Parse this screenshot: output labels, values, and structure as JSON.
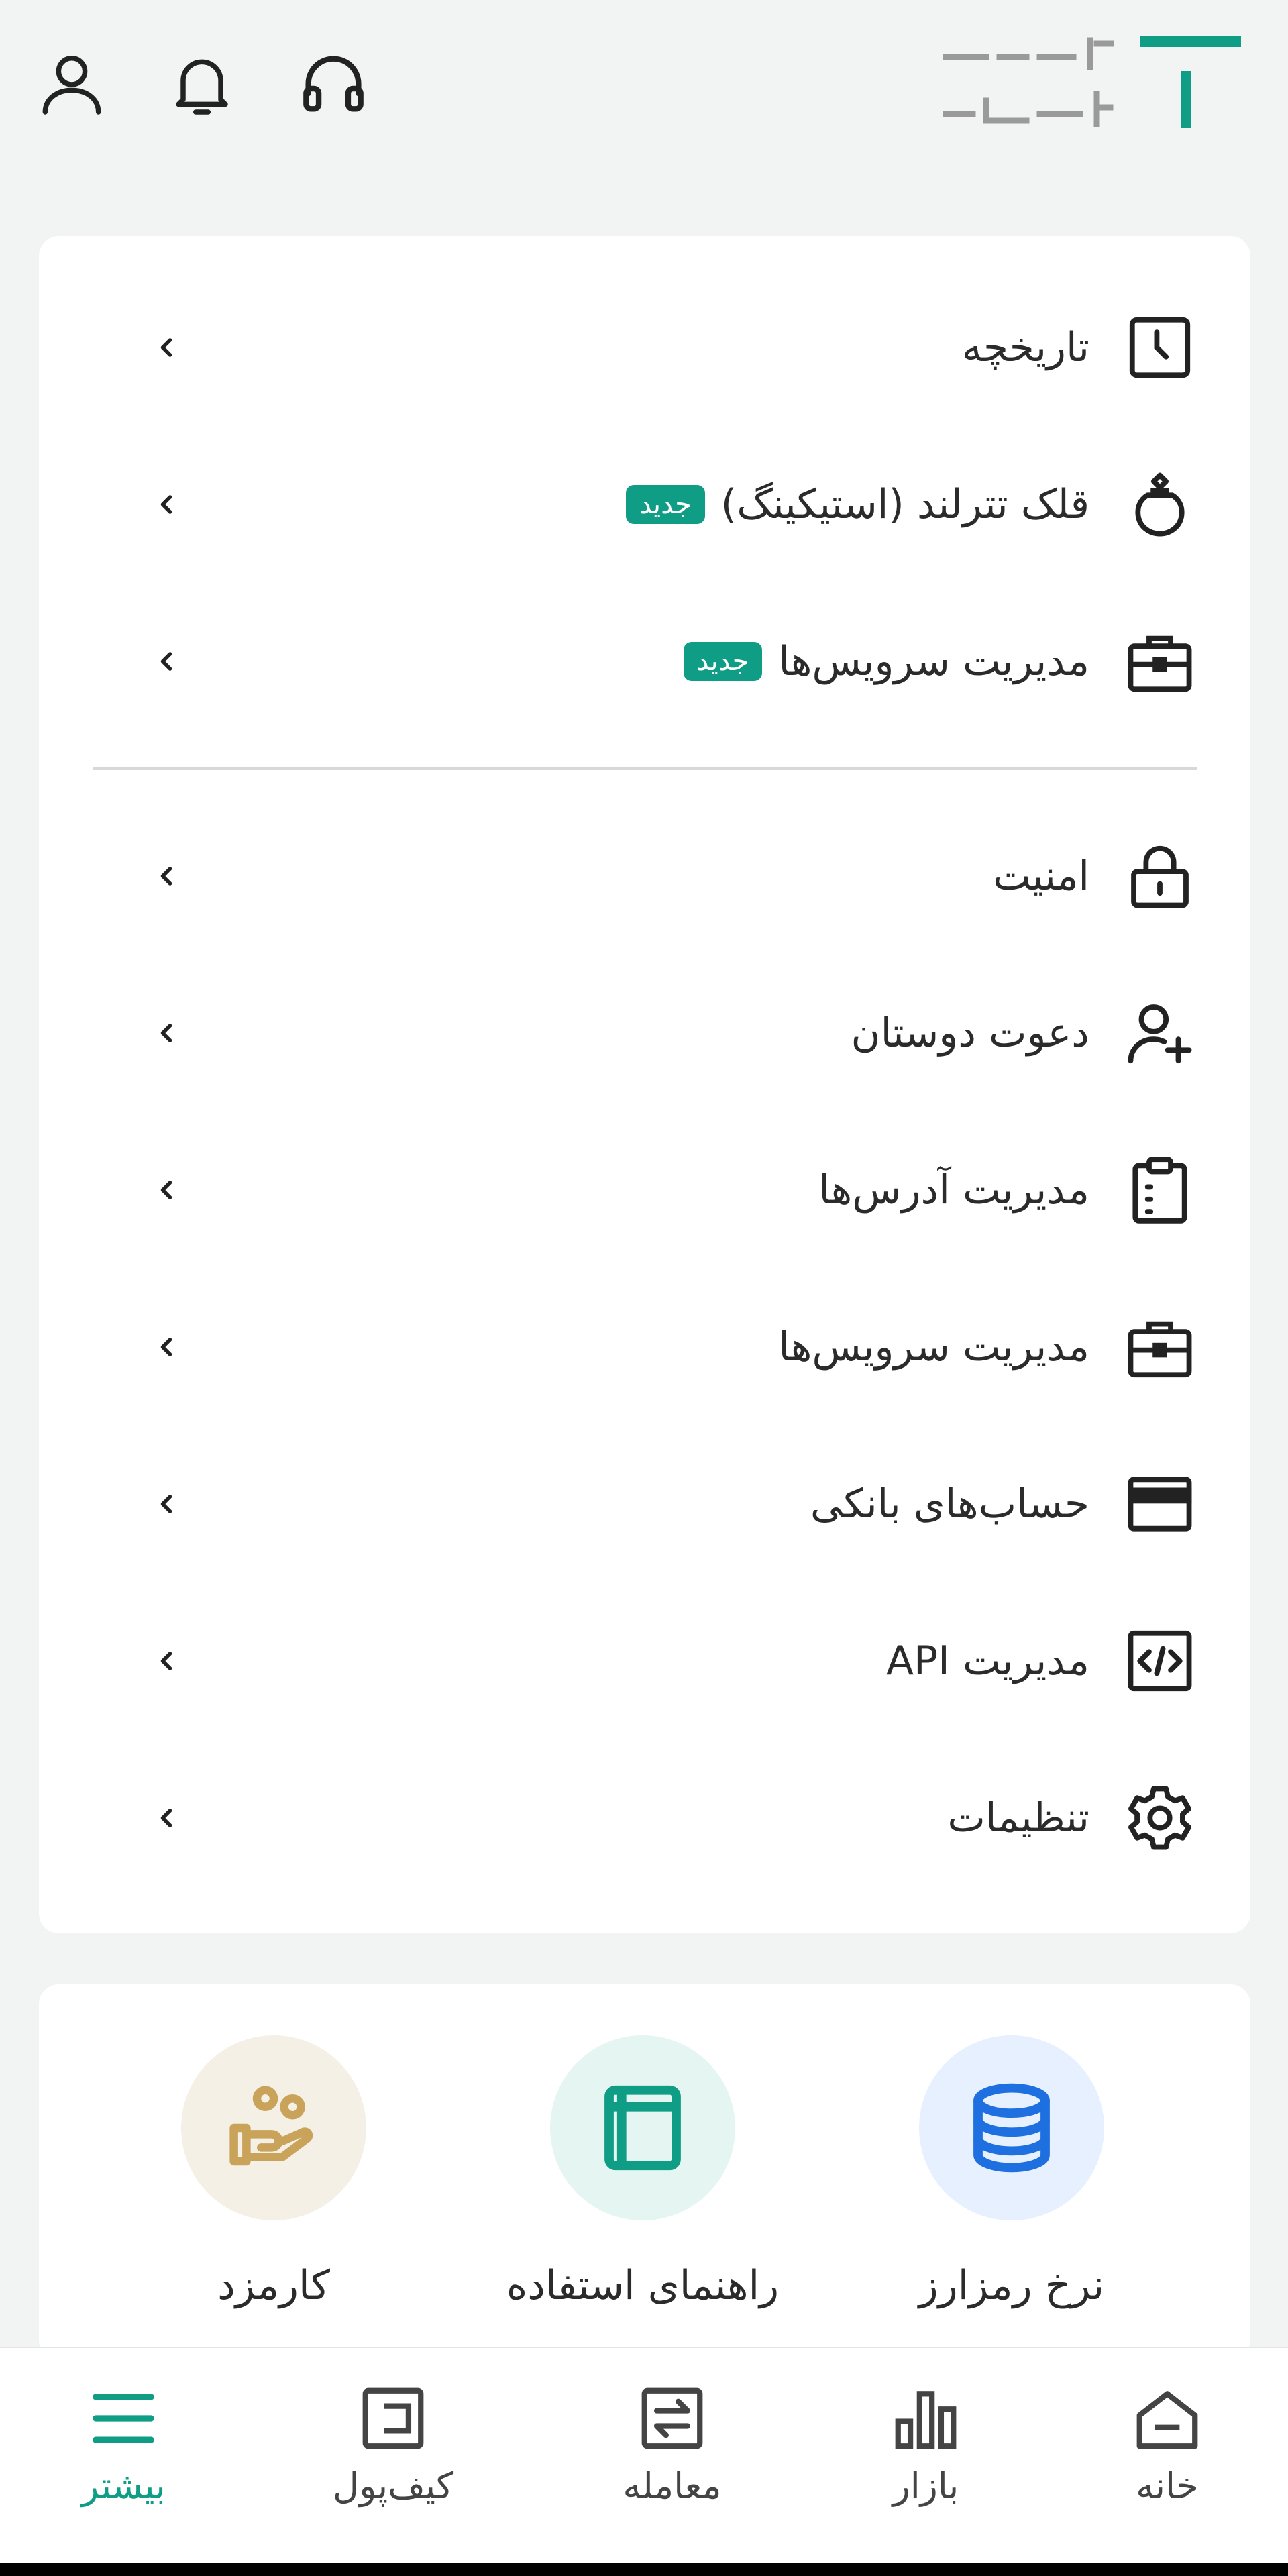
{
  "colors": {
    "accent": "#0F9D86",
    "background": "#F2F4F3",
    "card": "#FFFFFF",
    "rates_circle": "#E6F0FF",
    "guide_circle": "#E5F5F1",
    "fee_circle": "#F5F0E6",
    "fee_icon": "#C9A35A",
    "rates_icon": "#1E6FE0"
  },
  "header": {
    "logo_text": "تتر لند",
    "icons": [
      "profile-icon",
      "bell-icon",
      "headset-icon"
    ]
  },
  "menu": {
    "items": [
      {
        "label": "تاریخچه",
        "icon": "history-icon"
      },
      {
        "label": "قلک تترلند (استیکینگ)",
        "badge": "جدید",
        "icon": "piggy-bank-icon"
      },
      {
        "label": "مدیریت سرویس‌ها",
        "badge": "جدید",
        "icon": "briefcase-icon"
      },
      {
        "label": "امنیت",
        "icon": "lock-icon"
      },
      {
        "label": "دعوت دوستان",
        "icon": "add-user-icon"
      },
      {
        "label": "مدیریت آدرس‌ها",
        "icon": "clipboard-icon"
      },
      {
        "label": "مدیریت سرویس‌ها",
        "icon": "briefcase-icon"
      },
      {
        "label": "حساب‌های بانکی",
        "icon": "card-icon"
      },
      {
        "label": "مدیریت API",
        "icon": "code-icon"
      },
      {
        "label": "تنظیمات",
        "icon": "gear-icon"
      }
    ]
  },
  "quick_actions": [
    {
      "label": "نرخ رمزارز",
      "icon": "database-icon"
    },
    {
      "label": "راهنمای استفاده",
      "icon": "book-icon"
    },
    {
      "label": "کارمزد",
      "icon": "hand-coins-icon"
    }
  ],
  "bottom_nav": [
    {
      "label": "خانه",
      "icon": "home-icon",
      "active": false
    },
    {
      "label": "بازار",
      "icon": "bar-chart-icon",
      "active": false
    },
    {
      "label": "معامله",
      "icon": "swap-icon",
      "active": false
    },
    {
      "label": "کیف‌پول",
      "icon": "wallet-icon",
      "active": false
    },
    {
      "label": "بیشتر",
      "icon": "menu-icon",
      "active": true
    }
  ]
}
